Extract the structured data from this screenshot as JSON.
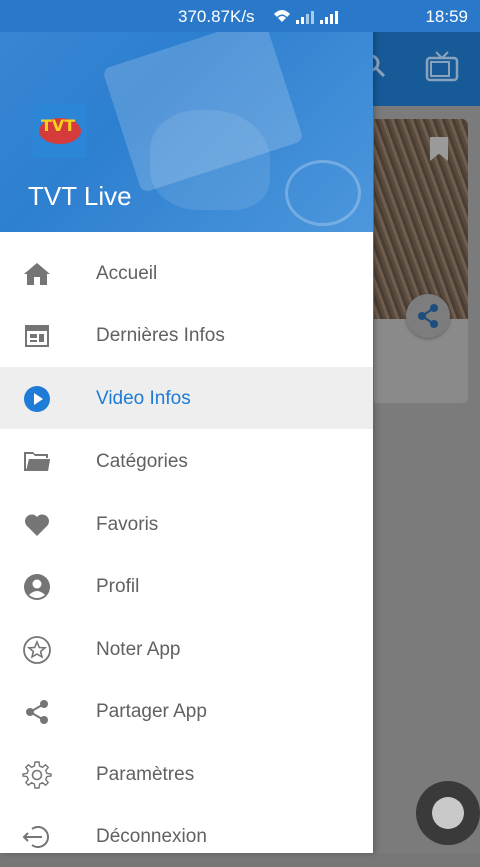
{
  "status_bar": {
    "speed": "370.87K/s",
    "time": "18:59"
  },
  "drawer": {
    "app_title": "TVT Live",
    "logo_text": "TVT",
    "items": [
      {
        "label": "Accueil",
        "icon": "home-icon",
        "active": false
      },
      {
        "label": "Dernières Infos",
        "icon": "calendar-icon",
        "active": false
      },
      {
        "label": "Video Infos",
        "icon": "play-circle-icon",
        "active": true
      },
      {
        "label": "Catégories",
        "icon": "folder-icon",
        "active": false
      },
      {
        "label": "Favoris",
        "icon": "heart-icon",
        "active": false
      },
      {
        "label": "Profil",
        "icon": "account-icon",
        "active": false
      },
      {
        "label": "Noter App",
        "icon": "star-circle-icon",
        "active": false
      },
      {
        "label": "Partager App",
        "icon": "share-icon",
        "active": false
      },
      {
        "label": "Paramètres",
        "icon": "gear-icon",
        "active": false
      },
      {
        "label": "Déconnexion",
        "icon": "logout-icon",
        "active": false
      }
    ]
  },
  "colors": {
    "accent": "#1e7bd6",
    "header": "#2d7fd0",
    "icon": "#757575"
  }
}
